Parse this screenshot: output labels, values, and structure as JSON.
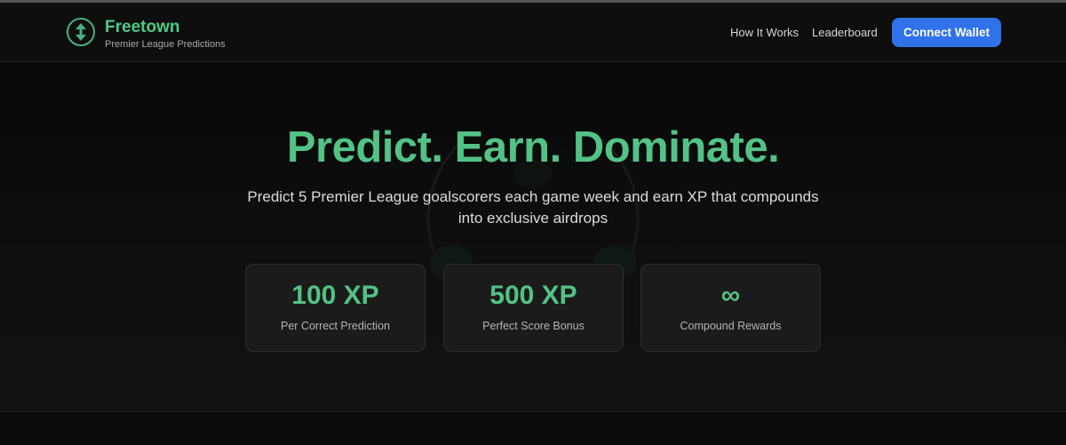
{
  "brand": {
    "name": "Freetown",
    "tagline": "Premier League Predictions",
    "logo_icon": "up-down-arrows-icon",
    "accent_color": "#4ecb88"
  },
  "nav": {
    "links": [
      "How It Works",
      "Leaderboard"
    ],
    "cta_label": "Connect Wallet",
    "cta_color": "#2f72ea"
  },
  "hero": {
    "headline": "Predict. Earn. Dominate.",
    "subtitle": "Predict 5 Premier League goalscorers each game week and earn XP that compounds into exclusive airdrops",
    "background_icon": "football-icon"
  },
  "stats": [
    {
      "value": "100 XP",
      "label": "Per Correct Prediction"
    },
    {
      "value": "500 XP",
      "label": "Perfect Score Bonus"
    },
    {
      "value": "∞",
      "label": "Compound Rewards"
    }
  ]
}
